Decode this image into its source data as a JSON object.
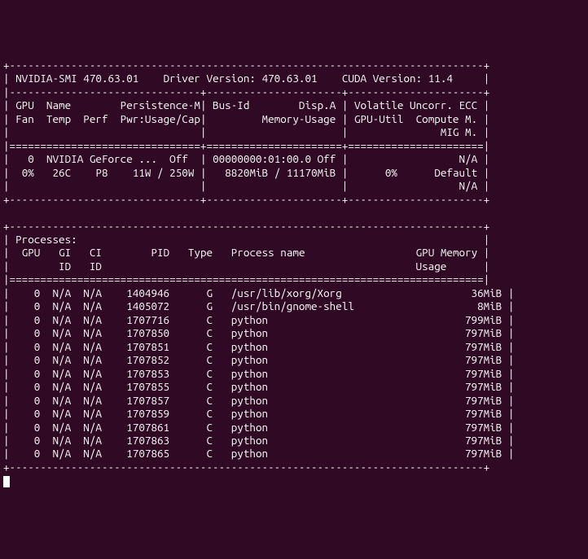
{
  "header": {
    "smi_label": "NVIDIA-SMI",
    "smi_version": "470.63.01",
    "driver_label": "Driver Version:",
    "driver_version": "470.63.01",
    "cuda_label": "CUDA Version:",
    "cuda_version": "11.4"
  },
  "gpu_table_headers": {
    "r1c1": "GPU  Name",
    "r1c2": "Persistence-M",
    "r1c3": "Bus-Id",
    "r1c4": "Disp.A",
    "r1c5": "Volatile Uncorr. ECC",
    "r2c1": "Fan  Temp  Perf",
    "r2c2": "Pwr:Usage/Cap",
    "r2c3": "Memory-Usage",
    "r2c4": "GPU-Util  Compute M.",
    "r3c1": "MIG M."
  },
  "gpu": {
    "index": "0",
    "name": "NVIDIA GeForce ...",
    "persistence": "Off",
    "bus_id": "00000000:01:00.0",
    "disp_a": "Off",
    "ecc": "N/A",
    "fan": "0%",
    "temp": "26C",
    "perf": "P8",
    "pwr": "11W / 250W",
    "mem": "8820MiB / 11170MiB",
    "util": "0%",
    "compute_mode": "Default",
    "mig_mode": "N/A"
  },
  "proc_header": {
    "title": "Processes:",
    "c1": "GPU",
    "c2": "GI",
    "c3": "CI",
    "c4": "PID",
    "c5": "Type",
    "c6": "Process name",
    "c7": "GPU Memory",
    "c2b": "ID",
    "c3b": "ID",
    "c7b": "Usage"
  },
  "chart_data": {
    "type": "table",
    "columns": [
      "GPU",
      "GI",
      "CI",
      "PID",
      "Type",
      "Process name",
      "GPU Memory"
    ],
    "rows": [
      [
        "0",
        "N/A",
        "N/A",
        "1404946",
        "G",
        "/usr/lib/xorg/Xorg",
        "36MiB"
      ],
      [
        "0",
        "N/A",
        "N/A",
        "1405072",
        "G",
        "/usr/bin/gnome-shell",
        "8MiB"
      ],
      [
        "0",
        "N/A",
        "N/A",
        "1707716",
        "C",
        "python",
        "799MiB"
      ],
      [
        "0",
        "N/A",
        "N/A",
        "1707850",
        "C",
        "python",
        "797MiB"
      ],
      [
        "0",
        "N/A",
        "N/A",
        "1707851",
        "C",
        "python",
        "797MiB"
      ],
      [
        "0",
        "N/A",
        "N/A",
        "1707852",
        "C",
        "python",
        "797MiB"
      ],
      [
        "0",
        "N/A",
        "N/A",
        "1707853",
        "C",
        "python",
        "797MiB"
      ],
      [
        "0",
        "N/A",
        "N/A",
        "1707855",
        "C",
        "python",
        "797MiB"
      ],
      [
        "0",
        "N/A",
        "N/A",
        "1707857",
        "C",
        "python",
        "797MiB"
      ],
      [
        "0",
        "N/A",
        "N/A",
        "1707859",
        "C",
        "python",
        "797MiB"
      ],
      [
        "0",
        "N/A",
        "N/A",
        "1707861",
        "C",
        "python",
        "797MiB"
      ],
      [
        "0",
        "N/A",
        "N/A",
        "1707863",
        "C",
        "python",
        "797MiB"
      ],
      [
        "0",
        "N/A",
        "N/A",
        "1707865",
        "C",
        "python",
        "797MiB"
      ]
    ]
  },
  "borders": {
    "top": "+-----------------------------------------------------------------------------+",
    "hdrsep": "|-------------------------------+----------------------+----------------------+",
    "eqsep": "|===============================+======================+======================|",
    "midbot": "+-------------------------------+----------------------+----------------------+",
    "eqsep2": "|=============================================================================|",
    "bot": "+-----------------------------------------------------------------------------+"
  }
}
